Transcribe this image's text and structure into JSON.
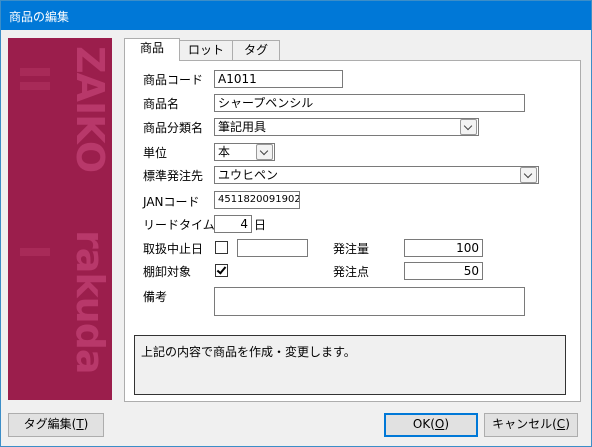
{
  "window": {
    "title": "商品の編集"
  },
  "sidebar": {
    "logo_top": "ZAIKO",
    "logo_bottom": "rakuda"
  },
  "tabs": [
    {
      "label": "商品",
      "active": true
    },
    {
      "label": "ロット",
      "active": false
    },
    {
      "label": "タグ",
      "active": false
    }
  ],
  "form": {
    "code_label": "商品コード",
    "code_value": "A1011",
    "name_label": "商品名",
    "name_value": "シャープペンシル",
    "category_label": "商品分類名",
    "category_value": "筆記用具",
    "unit_label": "単位",
    "unit_value": "本",
    "supplier_label": "標準発注先",
    "supplier_value": "ユウヒペン",
    "jan_label": "JANコード",
    "jan_value": "4511820091902",
    "leadtime_label": "リードタイム",
    "leadtime_value": "4",
    "leadtime_unit": "日",
    "discontinued_label": "取扱中止日",
    "discontinued_checked": false,
    "discontinued_date": "",
    "order_qty_label": "発注量",
    "order_qty_value": "100",
    "stocktake_label": "棚卸対象",
    "stocktake_checked": true,
    "order_point_label": "発注点",
    "order_point_value": "50",
    "memo_label": "備考",
    "memo_value": ""
  },
  "message": "上記の内容で商品を作成・変更します。",
  "buttons": {
    "tag_edit": "タグ編集(",
    "tag_edit_key": "T",
    "tag_edit_end": ")",
    "ok": "OK(",
    "ok_key": "O",
    "ok_end": ")",
    "cancel": "キャンセル(",
    "cancel_key": "C",
    "cancel_end": ")"
  }
}
